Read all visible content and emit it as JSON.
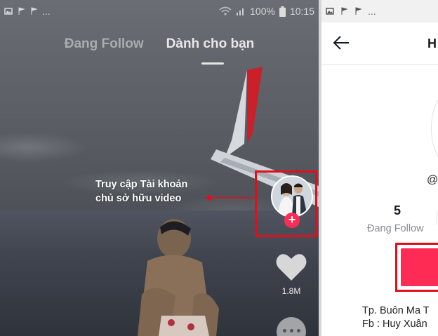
{
  "left_screen": {
    "status_bar": {
      "battery": "100%",
      "time": "10:15",
      "notif_ellipsis": "..."
    },
    "tabs": [
      {
        "label": "Đang Follow",
        "active": false
      },
      {
        "label": "Dành cho bạn",
        "active": true
      }
    ],
    "annotation": {
      "line1": "Truy cập Tài khoản",
      "line2": "chủ sở hữu video"
    },
    "follow_plus": "+",
    "like_count": "1.8M",
    "icons": [
      "gallery-icon",
      "flag-icon",
      "wifi-icon",
      "signal-icon",
      "battery-icon",
      "heart-icon",
      "more-icon",
      "arrow-left-icon"
    ],
    "colors": {
      "highlight": "#e30d1c",
      "accent": "#fe2c55"
    }
  },
  "right_screen": {
    "status_bar": {
      "notif_ellipsis": "..."
    },
    "header_title": "H",
    "handle": "@",
    "stats": {
      "following_count": "5",
      "following_label": "Đang Follow"
    },
    "bio": {
      "line1": "Tp. Buôn Ma T",
      "line2": "Fb : Huy Xuân"
    }
  }
}
